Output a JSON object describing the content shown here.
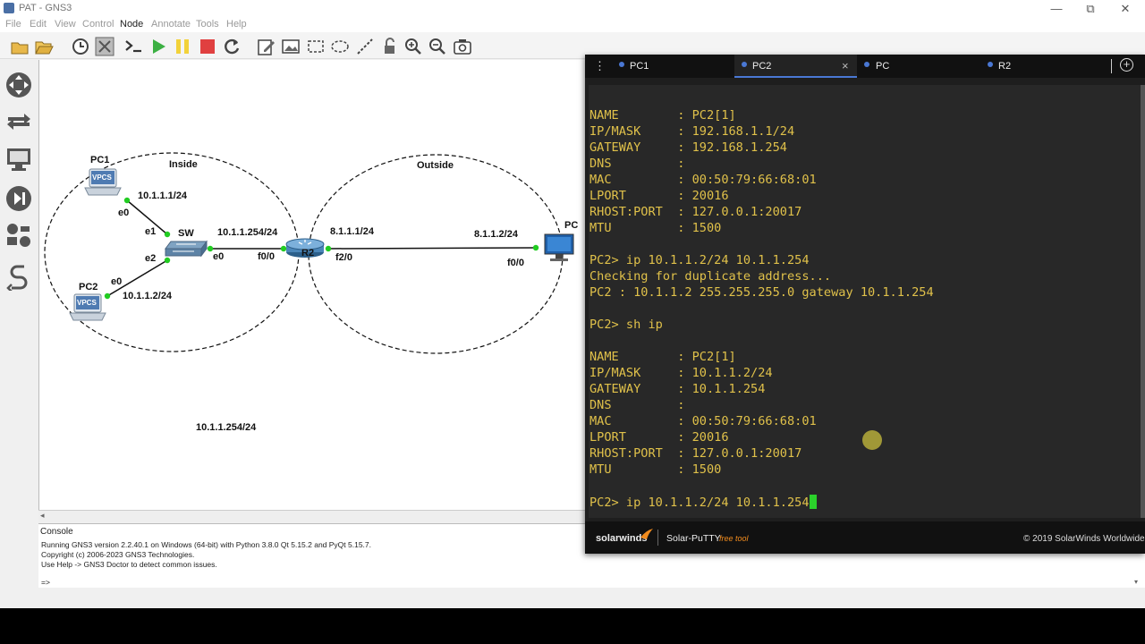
{
  "window": {
    "title": "PAT - GNS3",
    "minimize": "—",
    "maximize": "⧉",
    "close": "✕"
  },
  "menu": [
    "File",
    "Edit",
    "View",
    "Control",
    "Node",
    "Annotate",
    "Tools",
    "Help"
  ],
  "toolbar_icons": [
    "open-project-icon",
    "open-folder-icon",
    "snapshot-clock-icon",
    "show-interfaces-icon",
    "console-all-icon",
    "start-all-icon",
    "suspend-all-icon",
    "stop-all-icon",
    "reload-all-icon",
    "edit-note-icon",
    "insert-picture-icon",
    "draw-rectangle-icon",
    "draw-ellipse-icon",
    "draw-line-icon",
    "lock-icon",
    "zoom-in-icon",
    "zoom-out-icon",
    "screenshot-icon"
  ],
  "dock_icons": [
    "routers-icon",
    "switches-icon",
    "end-devices-icon",
    "security-devices-icon",
    "all-devices-icon",
    "add-link-icon"
  ],
  "topology": {
    "zones": {
      "inside": "Inside",
      "outside": "Outside"
    },
    "nodes": {
      "pc1": "PC1",
      "pc2": "PC2",
      "sw": "SW",
      "r2": "R2",
      "pc": "PC",
      "vpcs": "VPCS"
    },
    "labels": {
      "pc1_ip": "10.1.1.1/24",
      "pc1_e0": "e0",
      "sw_e1": "e1",
      "sw_e2": "e2",
      "sw_e0": "e0",
      "pc2_e0": "e0",
      "pc2_ip": "10.1.1.2/24",
      "r2_inside_ip": "10.1.1.254/24",
      "r2_f00": "f0/0",
      "r2_outside_ip": "8.1.1.1/24",
      "r2_f20": "f2/0",
      "pc_ip": "8.1.1.2/24",
      "pc_f00": "f0/0",
      "note": "10.1.1.254/24"
    }
  },
  "console": {
    "header": "Console",
    "lines": [
      "Running GNS3 version 2.2.40.1 on Windows (64-bit) with Python 3.8.0 Qt 5.15.2 and PyQt 5.15.7.",
      "Copyright (c) 2006-2023 GNS3 Technologies.",
      "Use Help -> GNS3 Doctor to detect common issues."
    ],
    "prompt": "=>"
  },
  "putty": {
    "tabs": [
      "PC1",
      "PC2",
      "PC",
      "R2"
    ],
    "active_tab": "PC2",
    "close_glyph": "×",
    "add_glyph": "+",
    "terminal_lines": [
      "NAME        : PC2[1]",
      "IP/MASK     : 192.168.1.1/24",
      "GATEWAY     : 192.168.1.254",
      "DNS         :",
      "MAC         : 00:50:79:66:68:01",
      "LPORT       : 20016",
      "RHOST:PORT  : 127.0.0.1:20017",
      "MTU         : 1500",
      "",
      "PC2> ip 10.1.1.2/24 10.1.1.254",
      "Checking for duplicate address...",
      "PC2 : 10.1.1.2 255.255.255.0 gateway 10.1.1.254",
      "",
      "PC2> sh ip",
      "",
      "NAME        : PC2[1]",
      "IP/MASK     : 10.1.1.2/24",
      "GATEWAY     : 10.1.1.254",
      "DNS         :",
      "MAC         : 00:50:79:66:68:01",
      "LPORT       : 20016",
      "RHOST:PORT  : 127.0.0.1:20017",
      "MTU         : 1500",
      "",
      "PC2> ip 10.1.1.2/24 10.1.1.254"
    ],
    "brand": "solarwinds",
    "product": "Solar-PuTTY",
    "product_tag": "free tool",
    "copyright": "© 2019 SolarWinds Worldwide"
  },
  "colors": {
    "terminal_text": "#e0c14a",
    "cursor": "#2bd12b",
    "tab_accent": "#4a78d4",
    "link_green": "#22cc22"
  }
}
